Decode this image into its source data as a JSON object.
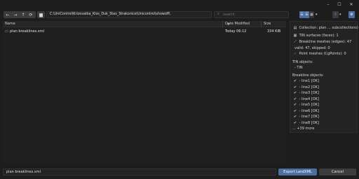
{
  "window": {
    "minimize": "–",
    "maximize": "☐",
    "close": "✕"
  },
  "toolbar": {
    "back_icon": "←",
    "forward_icon": "→",
    "up_icon": "↑",
    "refresh_icon": "⟳",
    "new_folder_icon": "▆",
    "path": "C:\\UniControl\\Krizovatka_Klos_Duk_Stav_Strakonice\\Unicontrol\\showoff\\",
    "search_placeholder": "Search",
    "search_icon": "⌕",
    "filter_icon": "⚲",
    "settings_icon": "⚙"
  },
  "file_list": {
    "columns": {
      "name": "Name",
      "date": "Date Modified",
      "size": "Size"
    },
    "sort_indicator": "▼",
    "rows": [
      {
        "icon": "▭",
        "name": "plan breaklines.xml",
        "date": "Today 06:12",
        "size": "334 KiB"
      }
    ]
  },
  "side_panel": {
    "collection": "Collection: plan ... subcollections)",
    "tin_surfaces": "TIN surfaces (faces): 1",
    "breakline_meshes": "Breakline meshes (edges): 47",
    "valid_skipped": "valid: 47, skipped: 0",
    "point_meshes": "Point meshes (CgPoints): 0",
    "tin_objects_label": "TIN objects:",
    "tin_objects": [
      "- TIN"
    ],
    "breakline_objects_label": "Breakline objects:",
    "breakline_objects": [
      "- line1 [OK]",
      "- line2 [OK]",
      "- line3 [OK]",
      "- line4 [OK]",
      "- line5 [OK]",
      "- line6 [OK]",
      "- line7 [OK]",
      "- line8 [OK]"
    ],
    "more": "... +39 more"
  },
  "footer": {
    "filename": "plan breaklines.xml",
    "export_label": "Export LandXML",
    "cancel_label": "Cancel"
  }
}
